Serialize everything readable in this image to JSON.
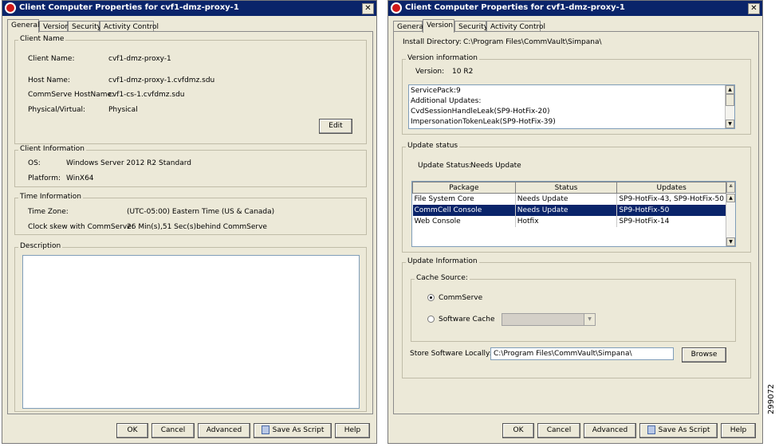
{
  "left": {
    "title": "Client Computer Properties for cvf1-dmz-proxy-1",
    "tabs": [
      "General",
      "Version",
      "Security",
      "Activity Control"
    ],
    "client_name_group": {
      "title": "Client Name",
      "client_name_label": "Client Name:",
      "client_name_value": "cvf1-dmz-proxy-1",
      "host_name_label": "Host Name:",
      "host_name_value": "cvf1-dmz-proxy-1.cvfdmz.sdu",
      "commserve_label": "CommServe HostName:",
      "commserve_value": "cvf1-cs-1.cvfdmz.sdu",
      "physical_label": "Physical/Virtual:",
      "physical_value": "Physical",
      "edit_button": "Edit"
    },
    "client_info_group": {
      "title": "Client Information",
      "os_label": "OS:",
      "os_value": "Windows Server 2012 R2 Standard",
      "platform_label": "Platform:",
      "platform_value": "WinX64"
    },
    "time_group": {
      "title": "Time Information",
      "zone_label": "Time Zone:",
      "zone_value": "(UTC-05:00) Eastern Time (US & Canada)",
      "skew_label": "Clock skew with CommServe:",
      "skew_value": "26 Min(s),51 Sec(s)behind CommServe"
    },
    "description_group": {
      "title": "Description",
      "value": ""
    },
    "buttons": {
      "ok": "OK",
      "cancel": "Cancel",
      "advanced": "Advanced",
      "save_script": "Save As Script",
      "help": "Help"
    }
  },
  "right": {
    "title": "Client Computer Properties for cvf1-dmz-proxy-1",
    "tabs": [
      "General",
      "Version",
      "Security",
      "Activity Control"
    ],
    "install_dir_label": "Install Directory:",
    "install_dir_value": "C:\\Program Files\\CommVault\\Simpana\\",
    "version_group": {
      "title": "Version information",
      "version_label": "Version:",
      "version_value": "10 R2",
      "lines": [
        "ServicePack:9",
        "Additional Updates:",
        "CvdSessionHandleLeak(SP9-HotFix-20)",
        "ImpersonationTokenLeak(SP9-HotFix-39)"
      ]
    },
    "update_status_group": {
      "title": "Update status",
      "status_label": "Update Status:",
      "status_value": "Needs Update",
      "columns": [
        "Package",
        "Status",
        "Updates"
      ],
      "rows": [
        {
          "package": "File System Core",
          "status": "Needs Update",
          "updates": "SP9-HotFix-43, SP9-HotFix-50"
        },
        {
          "package": "CommCell Console",
          "status": "Needs Update",
          "updates": "SP9-HotFix-50"
        },
        {
          "package": "Web Console",
          "status": "Hotfix",
          "updates": "SP9-HotFix-14"
        }
      ],
      "selected_row": 1
    },
    "update_info_group": {
      "title": "Update Information",
      "cache_source_title": "Cache Source:",
      "commserve_radio": "CommServe",
      "software_cache_radio": "Software Cache",
      "selected_radio": "CommServe",
      "store_label": "Store Software Locally:",
      "store_value": "C:\\Program Files\\CommVault\\Simpana\\",
      "browse_button": "Browse"
    },
    "buttons": {
      "ok": "OK",
      "cancel": "Cancel",
      "advanced": "Advanced",
      "save_script": "Save As Script",
      "help": "Help"
    }
  },
  "figure_id": "299072"
}
